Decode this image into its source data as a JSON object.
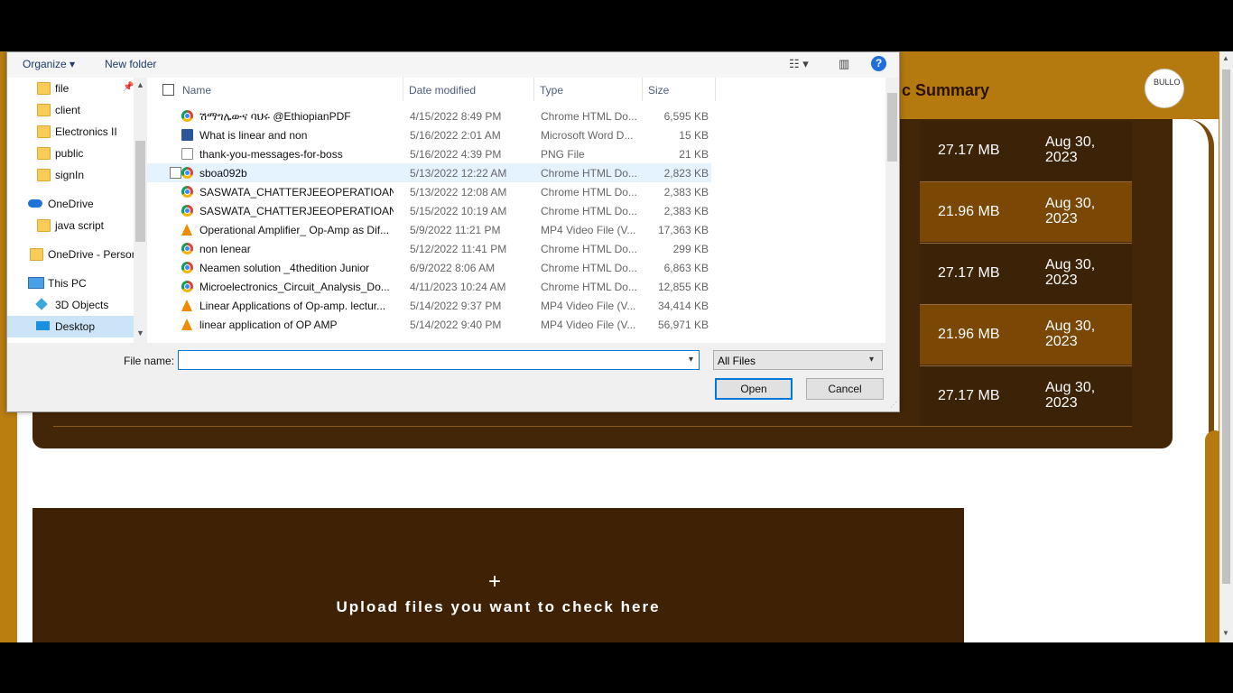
{
  "page": {
    "header_title": "c Summary",
    "logo_text": "BULLO",
    "rows": [
      {
        "size": "27.17 MB",
        "date": "Aug 30, 2023"
      },
      {
        "size": "21.96 MB",
        "date": "Aug 30, 2023"
      },
      {
        "size": "27.17 MB",
        "date": "Aug 30, 2023"
      },
      {
        "size": "21.96 MB",
        "date": "Aug 30, 2023"
      },
      {
        "size": "27.17 MB",
        "date": "Aug 30, 2023"
      }
    ],
    "upload_plus": "+",
    "upload_text": "Upload files you want to check here"
  },
  "dialog": {
    "toolbar": {
      "organize": "Organize ▾",
      "new_folder": "New folder",
      "view_icon": "view-options-icon",
      "preview_icon": "preview-pane-icon",
      "help": "?"
    },
    "nav": {
      "items": [
        {
          "label": "file",
          "icon": "folder-icon"
        },
        {
          "label": "client",
          "icon": "folder-icon"
        },
        {
          "label": "Electronics II",
          "icon": "folder-icon"
        },
        {
          "label": "public",
          "icon": "folder-icon"
        },
        {
          "label": "signIn",
          "icon": "folder-icon"
        },
        {
          "label": "OneDrive",
          "icon": "onedrive-icon"
        },
        {
          "label": "java script",
          "icon": "folder-icon"
        },
        {
          "label": "OneDrive - Persor",
          "icon": "folder-icon"
        },
        {
          "label": "This PC",
          "icon": "pc-icon"
        },
        {
          "label": "3D Objects",
          "icon": "cube-icon"
        },
        {
          "label": "Desktop",
          "icon": "desktop-icon"
        }
      ]
    },
    "columns": {
      "name": "Name",
      "date": "Date modified",
      "type": "Type",
      "size": "Size"
    },
    "files": [
      {
        "name": "ሽማግሌውና ባህሩ @EthiopianPDF",
        "date": "4/15/2022 8:49 PM",
        "type": "Chrome HTML Do...",
        "size": "6,595 KB",
        "icon": "chrome"
      },
      {
        "name": "What is linear and non",
        "date": "5/16/2022 2:01 AM",
        "type": "Microsoft Word D...",
        "size": "15 KB",
        "icon": "word"
      },
      {
        "name": "thank-you-messages-for-boss",
        "date": "5/16/2022 4:39 PM",
        "type": "PNG File",
        "size": "21 KB",
        "icon": "png"
      },
      {
        "name": "sboa092b",
        "date": "5/13/2022 12:22 AM",
        "type": "Chrome HTML Do...",
        "size": "2,823 KB",
        "icon": "chrome"
      },
      {
        "name": "SASWATA_CHATTERJEEOPERATIOANA...",
        "date": "5/13/2022 12:08 AM",
        "type": "Chrome HTML Do...",
        "size": "2,383 KB",
        "icon": "chrome"
      },
      {
        "name": "SASWATA_CHATTERJEEOPERATIOANA...",
        "date": "5/15/2022 10:19 AM",
        "type": "Chrome HTML Do...",
        "size": "2,383 KB",
        "icon": "chrome"
      },
      {
        "name": "Operational Amplifier_ Op-Amp as Dif...",
        "date": "5/9/2022 11:21 PM",
        "type": "MP4 Video File (V...",
        "size": "17,363 KB",
        "icon": "vlc"
      },
      {
        "name": "non lenear",
        "date": "5/12/2022 11:41 PM",
        "type": "Chrome HTML Do...",
        "size": "299 KB",
        "icon": "chrome"
      },
      {
        "name": "Neamen solution _4thedition Junior",
        "date": "6/9/2022 8:06 AM",
        "type": "Chrome HTML Do...",
        "size": "6,863 KB",
        "icon": "chrome"
      },
      {
        "name": "Microelectronics_Circuit_Analysis_Do...",
        "date": "4/11/2023 10:24 AM",
        "type": "Chrome HTML Do...",
        "size": "12,855 KB",
        "icon": "chrome"
      },
      {
        "name": "Linear Applications of Op-amp. lectur...",
        "date": "5/14/2022 9:37 PM",
        "type": "MP4 Video File (V...",
        "size": "34,414 KB",
        "icon": "vlc"
      },
      {
        "name": "linear application of OP AMP",
        "date": "5/14/2022 9:40 PM",
        "type": "MP4 Video File (V...",
        "size": "56,971 KB",
        "icon": "vlc"
      }
    ],
    "file_name_label": "File name:",
    "file_name_value": "",
    "filter_value": "All Files",
    "open_label": "Open",
    "cancel_label": "Cancel"
  }
}
